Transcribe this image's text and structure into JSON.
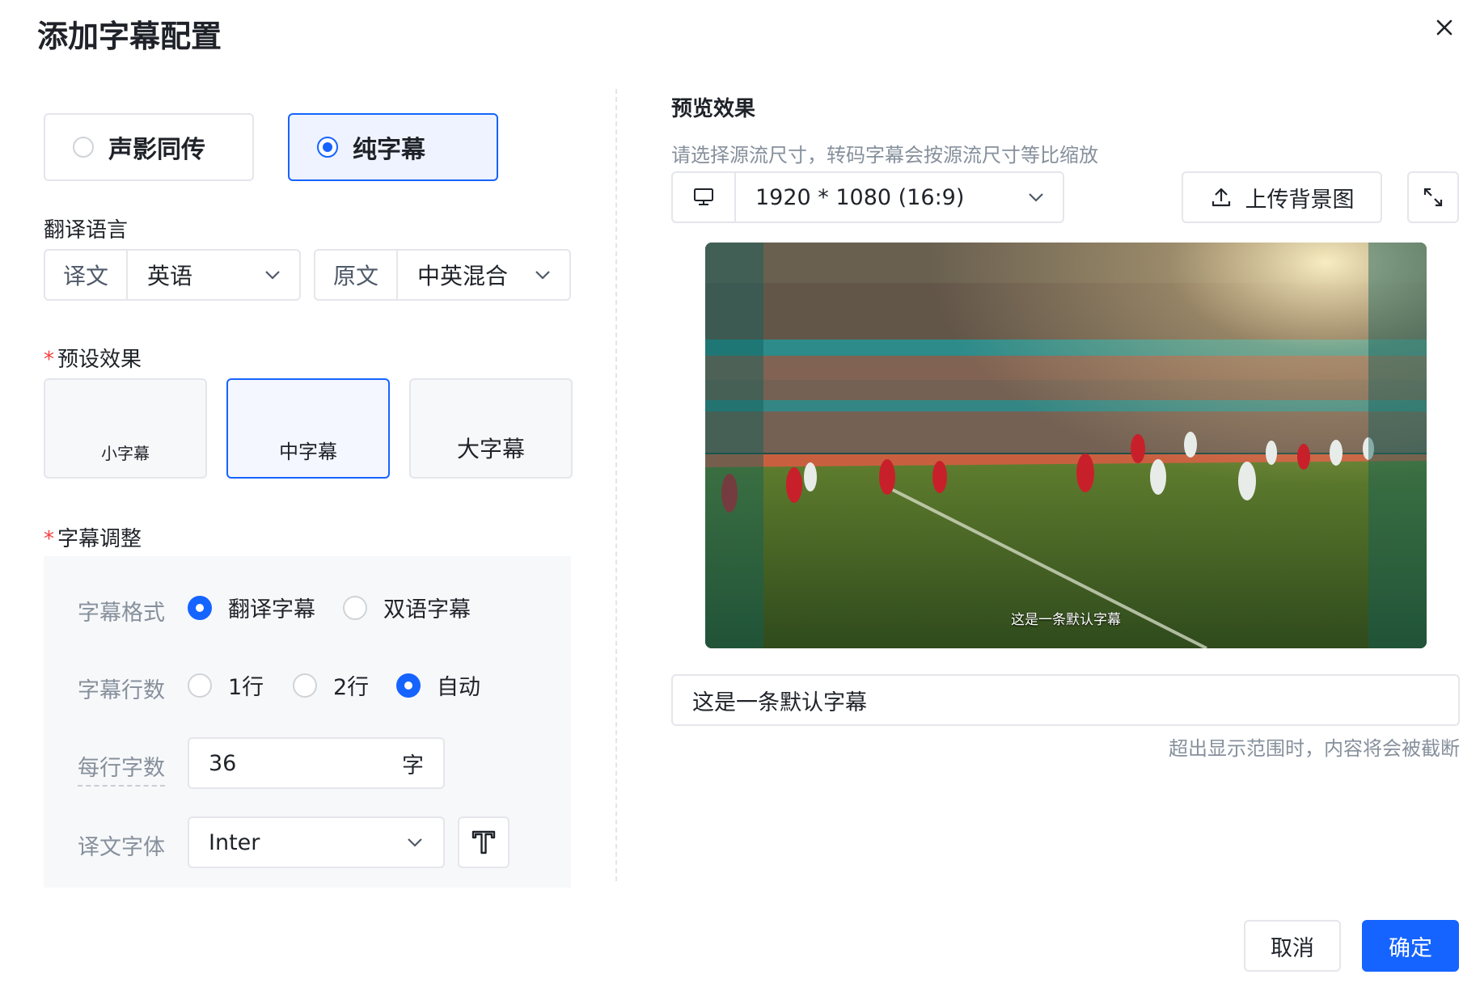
{
  "dialog": {
    "title": "添加字幕配置"
  },
  "mode": {
    "options": [
      {
        "label": "声影同传",
        "selected": false
      },
      {
        "label": "纯字幕",
        "selected": true
      }
    ]
  },
  "translation": {
    "label": "翻译语言",
    "target": {
      "prefix": "译文",
      "value": "英语"
    },
    "source": {
      "prefix": "原文",
      "value": "中英混合"
    }
  },
  "preset": {
    "label": "预设效果",
    "options": [
      {
        "label": "小字幕",
        "selected": false
      },
      {
        "label": "中字幕",
        "selected": true
      },
      {
        "label": "大字幕",
        "selected": false
      }
    ]
  },
  "adjust": {
    "label": "字幕调整",
    "format": {
      "label": "字幕格式",
      "options": [
        "翻译字幕",
        "双语字幕"
      ],
      "selected": "翻译字幕"
    },
    "lines": {
      "label": "字幕行数",
      "options": [
        "1行",
        "2行",
        "自动"
      ],
      "selected": "自动"
    },
    "chars": {
      "label": "每行字数",
      "value": "36",
      "unit": "字"
    },
    "font": {
      "label": "译文字体",
      "value": "Inter"
    }
  },
  "preview": {
    "title": "预览效果",
    "hint": "请选择源流尺寸，转码字幕会按源流尺寸等比缩放",
    "size": "1920 * 1080 (16:9)",
    "upload_label": "上传背景图",
    "subtitle_overlay": "这是一条默认字幕",
    "text_value": "这是一条默认字幕",
    "truncate_hint": "超出显示范围时，内容将会被截断"
  },
  "footer": {
    "cancel": "取消",
    "ok": "确定"
  },
  "colors": {
    "primary": "#1664ff",
    "required": "#f53f3f"
  }
}
